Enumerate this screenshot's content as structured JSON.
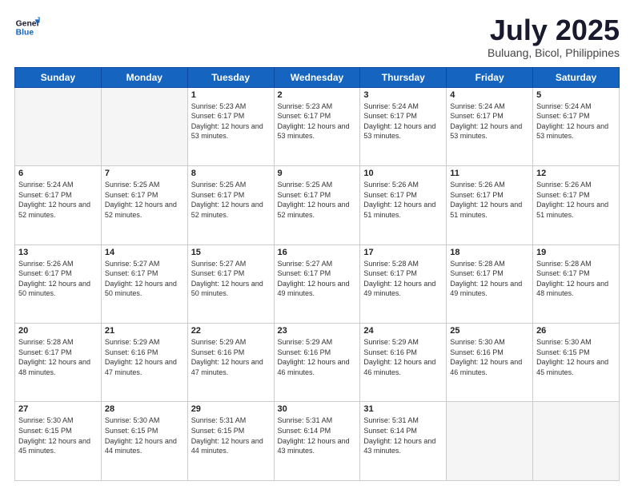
{
  "logo": {
    "line1": "General",
    "line2": "Blue"
  },
  "title": "July 2025",
  "location": "Buluang, Bicol, Philippines",
  "days_of_week": [
    "Sunday",
    "Monday",
    "Tuesday",
    "Wednesday",
    "Thursday",
    "Friday",
    "Saturday"
  ],
  "weeks": [
    [
      {
        "day": "",
        "sunrise": "",
        "sunset": "",
        "daylight": ""
      },
      {
        "day": "",
        "sunrise": "",
        "sunset": "",
        "daylight": ""
      },
      {
        "day": "1",
        "sunrise": "Sunrise: 5:23 AM",
        "sunset": "Sunset: 6:17 PM",
        "daylight": "Daylight: 12 hours and 53 minutes."
      },
      {
        "day": "2",
        "sunrise": "Sunrise: 5:23 AM",
        "sunset": "Sunset: 6:17 PM",
        "daylight": "Daylight: 12 hours and 53 minutes."
      },
      {
        "day": "3",
        "sunrise": "Sunrise: 5:24 AM",
        "sunset": "Sunset: 6:17 PM",
        "daylight": "Daylight: 12 hours and 53 minutes."
      },
      {
        "day": "4",
        "sunrise": "Sunrise: 5:24 AM",
        "sunset": "Sunset: 6:17 PM",
        "daylight": "Daylight: 12 hours and 53 minutes."
      },
      {
        "day": "5",
        "sunrise": "Sunrise: 5:24 AM",
        "sunset": "Sunset: 6:17 PM",
        "daylight": "Daylight: 12 hours and 53 minutes."
      }
    ],
    [
      {
        "day": "6",
        "sunrise": "Sunrise: 5:24 AM",
        "sunset": "Sunset: 6:17 PM",
        "daylight": "Daylight: 12 hours and 52 minutes."
      },
      {
        "day": "7",
        "sunrise": "Sunrise: 5:25 AM",
        "sunset": "Sunset: 6:17 PM",
        "daylight": "Daylight: 12 hours and 52 minutes."
      },
      {
        "day": "8",
        "sunrise": "Sunrise: 5:25 AM",
        "sunset": "Sunset: 6:17 PM",
        "daylight": "Daylight: 12 hours and 52 minutes."
      },
      {
        "day": "9",
        "sunrise": "Sunrise: 5:25 AM",
        "sunset": "Sunset: 6:17 PM",
        "daylight": "Daylight: 12 hours and 52 minutes."
      },
      {
        "day": "10",
        "sunrise": "Sunrise: 5:26 AM",
        "sunset": "Sunset: 6:17 PM",
        "daylight": "Daylight: 12 hours and 51 minutes."
      },
      {
        "day": "11",
        "sunrise": "Sunrise: 5:26 AM",
        "sunset": "Sunset: 6:17 PM",
        "daylight": "Daylight: 12 hours and 51 minutes."
      },
      {
        "day": "12",
        "sunrise": "Sunrise: 5:26 AM",
        "sunset": "Sunset: 6:17 PM",
        "daylight": "Daylight: 12 hours and 51 minutes."
      }
    ],
    [
      {
        "day": "13",
        "sunrise": "Sunrise: 5:26 AM",
        "sunset": "Sunset: 6:17 PM",
        "daylight": "Daylight: 12 hours and 50 minutes."
      },
      {
        "day": "14",
        "sunrise": "Sunrise: 5:27 AM",
        "sunset": "Sunset: 6:17 PM",
        "daylight": "Daylight: 12 hours and 50 minutes."
      },
      {
        "day": "15",
        "sunrise": "Sunrise: 5:27 AM",
        "sunset": "Sunset: 6:17 PM",
        "daylight": "Daylight: 12 hours and 50 minutes."
      },
      {
        "day": "16",
        "sunrise": "Sunrise: 5:27 AM",
        "sunset": "Sunset: 6:17 PM",
        "daylight": "Daylight: 12 hours and 49 minutes."
      },
      {
        "day": "17",
        "sunrise": "Sunrise: 5:28 AM",
        "sunset": "Sunset: 6:17 PM",
        "daylight": "Daylight: 12 hours and 49 minutes."
      },
      {
        "day": "18",
        "sunrise": "Sunrise: 5:28 AM",
        "sunset": "Sunset: 6:17 PM",
        "daylight": "Daylight: 12 hours and 49 minutes."
      },
      {
        "day": "19",
        "sunrise": "Sunrise: 5:28 AM",
        "sunset": "Sunset: 6:17 PM",
        "daylight": "Daylight: 12 hours and 48 minutes."
      }
    ],
    [
      {
        "day": "20",
        "sunrise": "Sunrise: 5:28 AM",
        "sunset": "Sunset: 6:17 PM",
        "daylight": "Daylight: 12 hours and 48 minutes."
      },
      {
        "day": "21",
        "sunrise": "Sunrise: 5:29 AM",
        "sunset": "Sunset: 6:16 PM",
        "daylight": "Daylight: 12 hours and 47 minutes."
      },
      {
        "day": "22",
        "sunrise": "Sunrise: 5:29 AM",
        "sunset": "Sunset: 6:16 PM",
        "daylight": "Daylight: 12 hours and 47 minutes."
      },
      {
        "day": "23",
        "sunrise": "Sunrise: 5:29 AM",
        "sunset": "Sunset: 6:16 PM",
        "daylight": "Daylight: 12 hours and 46 minutes."
      },
      {
        "day": "24",
        "sunrise": "Sunrise: 5:29 AM",
        "sunset": "Sunset: 6:16 PM",
        "daylight": "Daylight: 12 hours and 46 minutes."
      },
      {
        "day": "25",
        "sunrise": "Sunrise: 5:30 AM",
        "sunset": "Sunset: 6:16 PM",
        "daylight": "Daylight: 12 hours and 46 minutes."
      },
      {
        "day": "26",
        "sunrise": "Sunrise: 5:30 AM",
        "sunset": "Sunset: 6:15 PM",
        "daylight": "Daylight: 12 hours and 45 minutes."
      }
    ],
    [
      {
        "day": "27",
        "sunrise": "Sunrise: 5:30 AM",
        "sunset": "Sunset: 6:15 PM",
        "daylight": "Daylight: 12 hours and 45 minutes."
      },
      {
        "day": "28",
        "sunrise": "Sunrise: 5:30 AM",
        "sunset": "Sunset: 6:15 PM",
        "daylight": "Daylight: 12 hours and 44 minutes."
      },
      {
        "day": "29",
        "sunrise": "Sunrise: 5:31 AM",
        "sunset": "Sunset: 6:15 PM",
        "daylight": "Daylight: 12 hours and 44 minutes."
      },
      {
        "day": "30",
        "sunrise": "Sunrise: 5:31 AM",
        "sunset": "Sunset: 6:14 PM",
        "daylight": "Daylight: 12 hours and 43 minutes."
      },
      {
        "day": "31",
        "sunrise": "Sunrise: 5:31 AM",
        "sunset": "Sunset: 6:14 PM",
        "daylight": "Daylight: 12 hours and 43 minutes."
      },
      {
        "day": "",
        "sunrise": "",
        "sunset": "",
        "daylight": ""
      },
      {
        "day": "",
        "sunrise": "",
        "sunset": "",
        "daylight": ""
      }
    ]
  ]
}
